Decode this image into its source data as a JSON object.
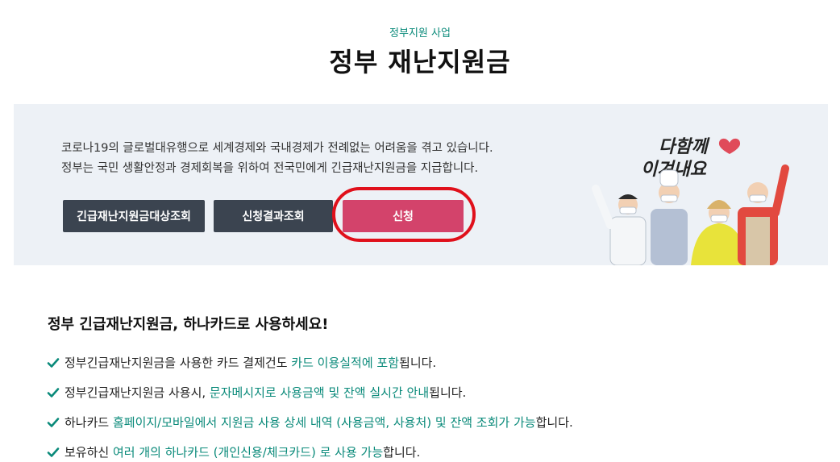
{
  "header": {
    "eyebrow": "정부지원 사업",
    "title": "정부 재난지원금"
  },
  "banner": {
    "line1": "코로나19의 글로벌대유행으로 세계경제와 국내경제가 전례없는 어려움을 겪고 있습니다.",
    "line2": "정부는 국민 생활안정과 경제회복을 위하여 전국민에게 긴급재난지원금을 지급합니다.",
    "buttons": {
      "eligibility": "긴급재난지원금대상조회",
      "result": "신청결과조회",
      "apply": "신청"
    },
    "illustration_text": "다함께 이겨내요"
  },
  "section": {
    "heading": "정부 긴급재난지원금, 하나카드로 사용하세요!",
    "items": [
      {
        "pre": "정부긴급재난지원금을 사용한 카드 결제건도 ",
        "hl": "카드 이용실적에 포함",
        "post": "됩니다."
      },
      {
        "pre": "정부긴급재난지원금 사용시, ",
        "hl": "문자메시지로 사용금액 및 잔액 실시간 안내",
        "post": "됩니다."
      },
      {
        "pre": "하나카드 ",
        "hl": "홈페이지/모바일에서 지원금 사용 상세 내역 (사용금액, 사용처) 및 잔액 조회가 가능",
        "post": "합니다."
      },
      {
        "pre": "보유하신 ",
        "hl": "여러 개의 하나카드 (개인신용/체크카드) 로 사용 가능",
        "post": "합니다."
      }
    ]
  },
  "colors": {
    "accent_teal": "#0a8a7a",
    "apply_button": "#d3436b",
    "dark_button": "#3b4450",
    "banner_bg": "#edf1f6",
    "highlight_ring": "#e0101b"
  }
}
